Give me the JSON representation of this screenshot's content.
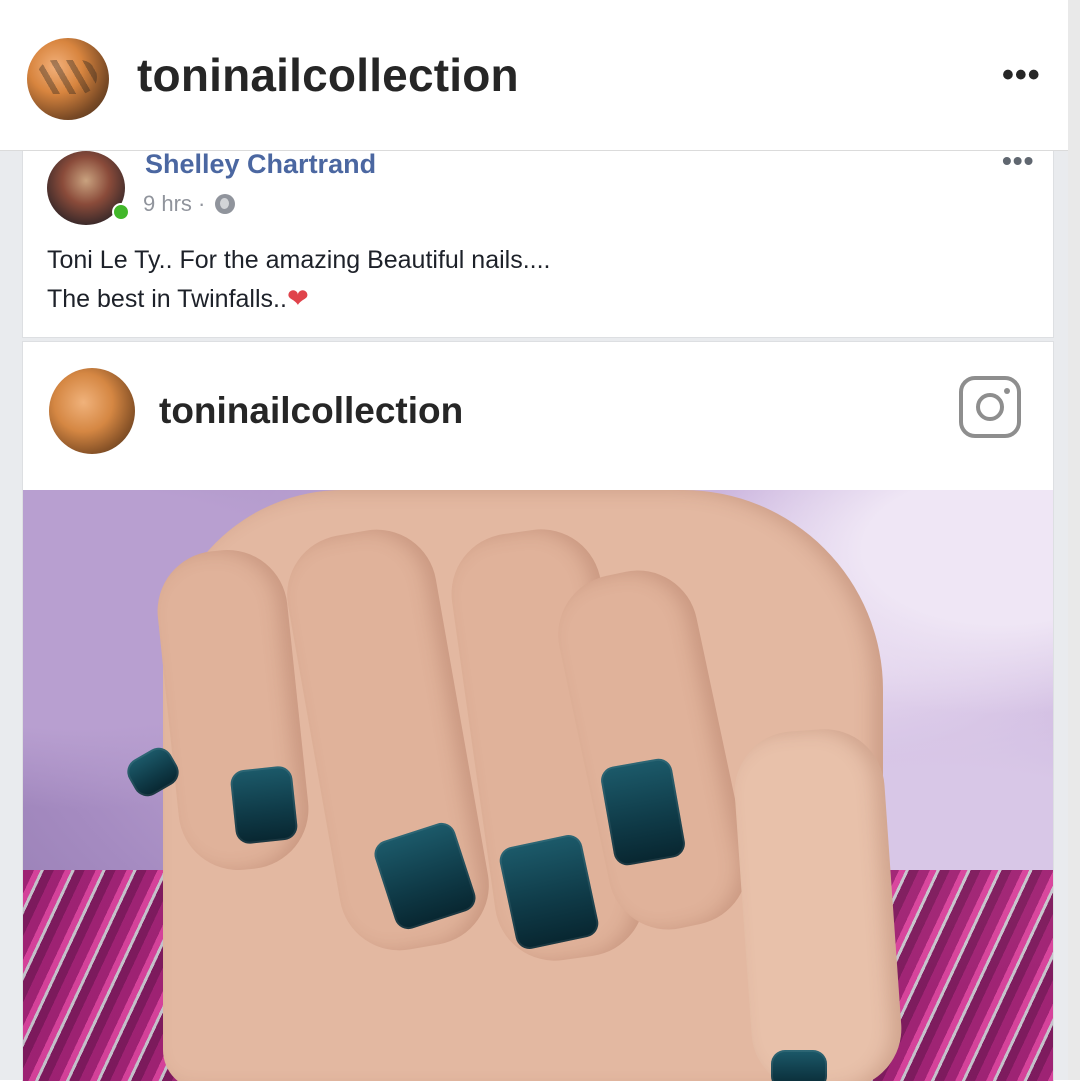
{
  "instagram_header": {
    "username": "toninailcollection",
    "more_label": "•••"
  },
  "facebook_post": {
    "author": "Shelley Chartrand",
    "time": "9 hrs ·",
    "more_label": "•••",
    "text_line1": "Toni Le Ty.. For the amazing Beautiful nails....",
    "text_line2": "The best in Twinfalls..",
    "heart": "❤"
  },
  "instagram_embed": {
    "username": "toninailcollection"
  },
  "colors": {
    "fb_name": "#4b67a1",
    "fb_meta": "#90949c",
    "ig_text": "#262626",
    "nail_polish": "#0f3a47",
    "background_fur": "#c8b1dc",
    "tinsel": "#9e1a6d"
  },
  "icons": [
    "more-icon",
    "globe-icon",
    "online-status-icon",
    "instagram-logo-icon",
    "heart-icon"
  ]
}
